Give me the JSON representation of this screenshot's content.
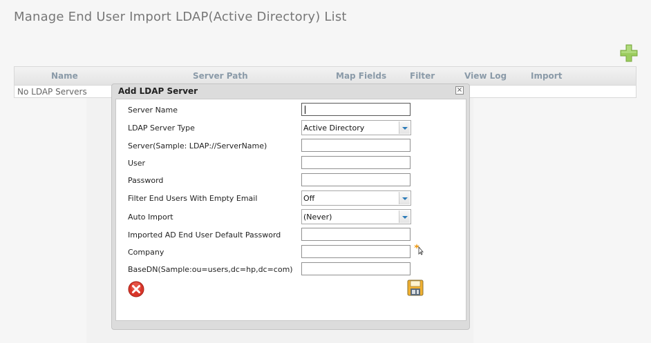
{
  "page": {
    "title": "Manage End User Import LDAP(Active Directory) List"
  },
  "toolbar": {
    "add_icon": "add-icon",
    "colors": {
      "add": "#9bcc5e"
    }
  },
  "grid": {
    "columns": [
      "Name",
      "Server Path",
      "Map Fields",
      "Filter",
      "View Log",
      "Import"
    ],
    "empty_text": "No LDAP Servers"
  },
  "dialog": {
    "title": "Add LDAP Server",
    "close_icon": "close-icon",
    "fields": {
      "server_name": {
        "label": "Server Name",
        "value": ""
      },
      "server_type": {
        "label": "LDAP Server Type",
        "value": "Active Directory"
      },
      "server": {
        "label": "Server(Sample: LDAP://ServerName)",
        "value": ""
      },
      "user": {
        "label": "User",
        "value": ""
      },
      "password": {
        "label": "Password",
        "value": ""
      },
      "filter_empty_email": {
        "label": "Filter End Users With Empty Email",
        "value": "Off"
      },
      "auto_import": {
        "label": "Auto Import",
        "value": "(Never)"
      },
      "default_password": {
        "label": "Imported AD End User Default Password",
        "value": ""
      },
      "company": {
        "label": "Company",
        "value": "",
        "picker_icon": "company-picker-icon"
      },
      "basedn": {
        "label": "BaseDN(Sample:ou=users,dc=hp,dc=com)",
        "value": ""
      }
    },
    "buttons": {
      "cancel_icon": "cancel-icon",
      "save_icon": "save-icon"
    },
    "colors": {
      "cancel": "#d9362a",
      "dropdown_arrow": "#2a7ab8"
    }
  }
}
